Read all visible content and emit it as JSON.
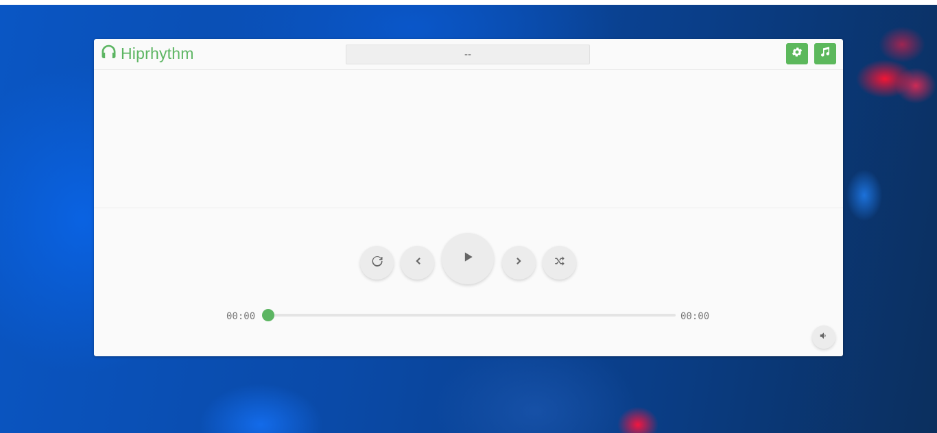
{
  "app": {
    "logo_text": "Hiprhythm",
    "accent_color": "#5cb85c"
  },
  "header": {
    "now_playing": "--",
    "buttons": [
      {
        "name": "settings",
        "icon": "gear-icon"
      },
      {
        "name": "playlist",
        "icon": "music-note-icon"
      }
    ]
  },
  "controls": {
    "buttons": [
      {
        "name": "repeat",
        "icon": "refresh-icon"
      },
      {
        "name": "previous",
        "icon": "chevron-left-icon"
      },
      {
        "name": "play",
        "icon": "play-icon"
      },
      {
        "name": "next",
        "icon": "chevron-right-icon"
      },
      {
        "name": "shuffle",
        "icon": "shuffle-icon"
      }
    ]
  },
  "progress": {
    "current_time": "00:00",
    "total_time": "00:00",
    "fraction": 0
  },
  "volume": {
    "icon": "volume-icon"
  }
}
